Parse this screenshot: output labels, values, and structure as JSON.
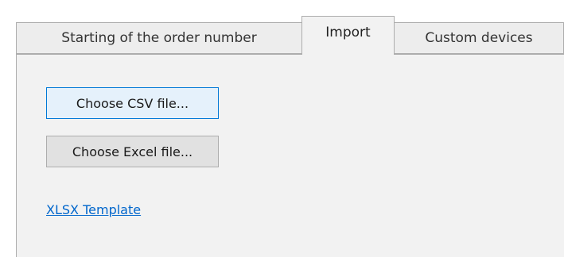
{
  "tabs": {
    "order_number": "Starting of the order number",
    "import": "Import",
    "custom_devices": "Custom devices"
  },
  "import_panel": {
    "choose_csv_label": "Choose CSV file...",
    "choose_excel_label": "Choose Excel file...",
    "xlsx_template_link": "XLSX Template"
  },
  "active_tab": "Import"
}
